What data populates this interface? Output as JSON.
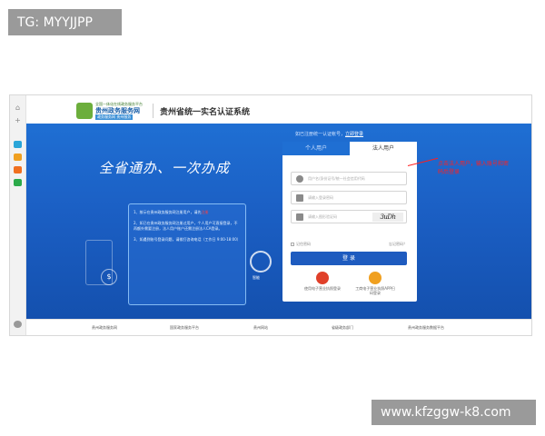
{
  "watermarks": {
    "top": "TG: MYYJJPP",
    "bottom": "www.kfzggw-k8.com"
  },
  "sidebar": {
    "icons": [
      "home-icon",
      "plus-icon",
      "apps-icon",
      "document-icon",
      "box-icon",
      "card-icon",
      "settings-icon"
    ]
  },
  "header": {
    "logo_small": "全国一体化在线政务服务平台",
    "logo_name": "贵州政务服务网",
    "logo_sub": "政务服务网 贵州服务",
    "title": "贵州省统一实名认证系统"
  },
  "hero": {
    "slogan": "全省通办、一次办成",
    "notice": [
      "1、按示在贵州政务服务网注册用户，请先",
      "2、如已在贵州政务服务网注册过用户，个人用户可直接登录，不再额外需要注册，法人用户账户还需注册法人CA登录。",
      "3、如遇到账号登录问题，请拨打咨询电话（工作日 9:00-18:00）"
    ],
    "notice_highlight": "注册",
    "robot_label": "智能"
  },
  "login": {
    "hint": "如已注册统一认证帐号，",
    "hint_link": "立即登录",
    "tab_personal": "个人用户",
    "tab_legal": "法人用户",
    "username_placeholder": "用户名/身份证号/统一社会信用代码",
    "password_placeholder": "请输入登录密码",
    "captcha_placeholder": "请输入图形验证码",
    "captcha_text": "3uDh",
    "remember_label": "记住密码",
    "forgot_label": "忘记密码？",
    "submit_label": "登 录",
    "option1_label": "使用电子营业执照登录",
    "option2_label": "工商电子营业执照APP扫码登录"
  },
  "annotation": "点击法人用户，输入账号和密码后登录",
  "footer": {
    "links": [
      "贵州政务服务网",
      "国家政务服务平台",
      "贵州网站",
      "省级政务部门",
      "贵州政务服务数据平台"
    ]
  },
  "colors": {
    "hero": "#1f6fd3",
    "button": "#1e5bbf",
    "annotation": "#ff2020"
  }
}
